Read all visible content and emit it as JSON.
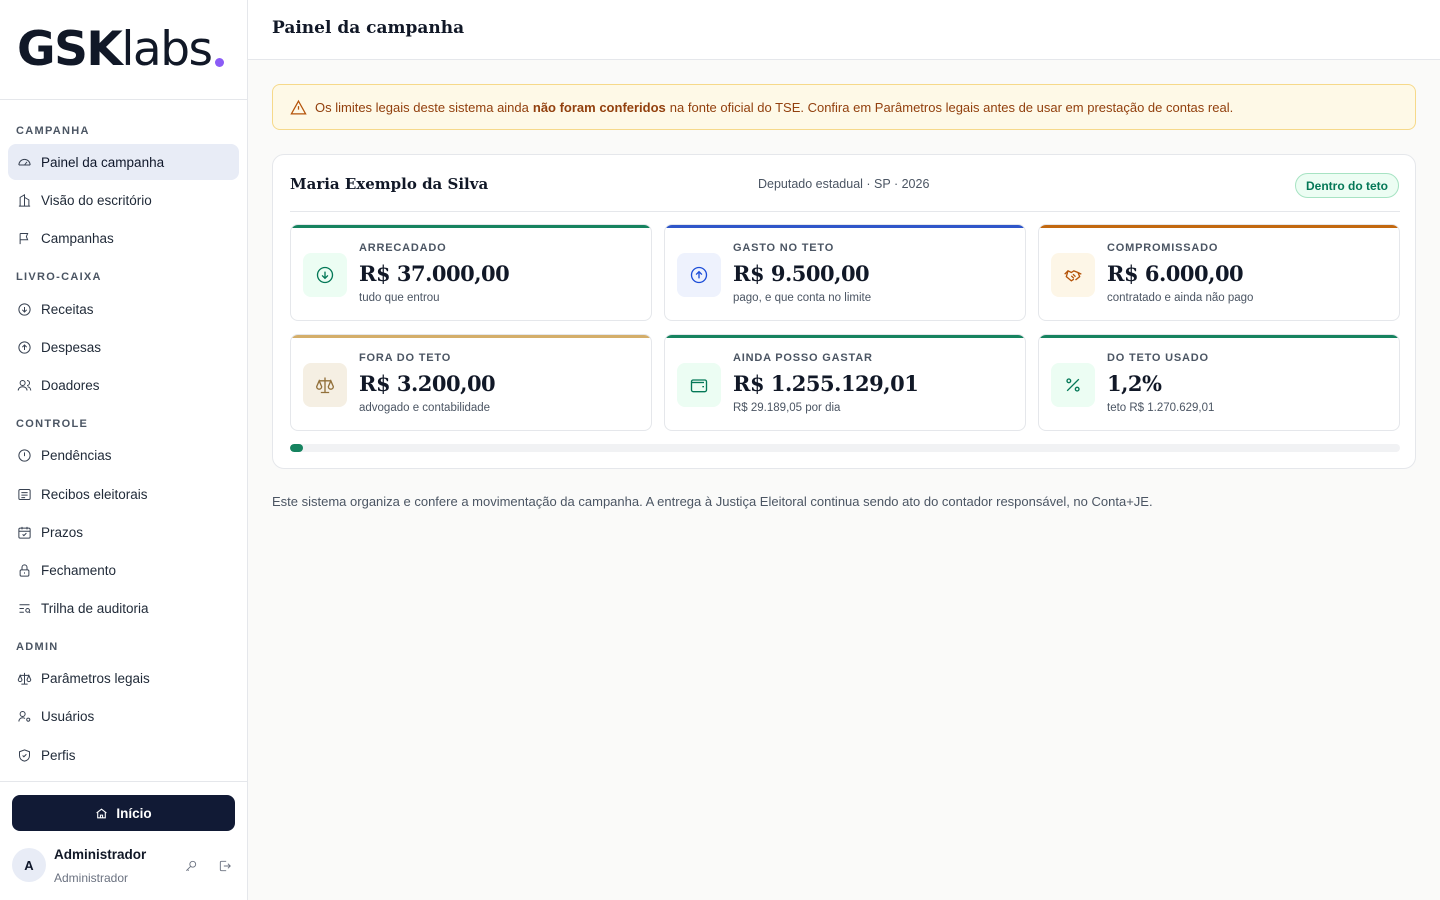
{
  "logo": {
    "bold": "GSK",
    "light": "labs"
  },
  "sidebar": {
    "sections": [
      {
        "title": "CAMPANHA",
        "items": [
          {
            "label": "Painel da campanha",
            "icon": "dashboard-icon",
            "active": true
          },
          {
            "label": "Visão do escritório",
            "icon": "building-icon"
          },
          {
            "label": "Campanhas",
            "icon": "flag-icon"
          }
        ]
      },
      {
        "title": "LIVRO-CAIXA",
        "items": [
          {
            "label": "Receitas",
            "icon": "arrow-down-circle-icon"
          },
          {
            "label": "Despesas",
            "icon": "arrow-up-circle-icon"
          },
          {
            "label": "Doadores",
            "icon": "users-icon"
          }
        ]
      },
      {
        "title": "CONTROLE",
        "items": [
          {
            "label": "Pendências",
            "icon": "alert-circle-icon"
          },
          {
            "label": "Recibos eleitorais",
            "icon": "receipt-icon"
          },
          {
            "label": "Prazos",
            "icon": "calendar-check-icon"
          },
          {
            "label": "Fechamento",
            "icon": "lock-icon"
          },
          {
            "label": "Trilha de auditoria",
            "icon": "list-search-icon"
          }
        ]
      },
      {
        "title": "ADMIN",
        "items": [
          {
            "label": "Parâmetros legais",
            "icon": "scale-icon"
          },
          {
            "label": "Usuários",
            "icon": "user-cog-icon"
          },
          {
            "label": "Perfis",
            "icon": "shield-check-icon"
          }
        ]
      }
    ],
    "home_label": "Início",
    "user": {
      "initial": "A",
      "name": "Administrador",
      "role": "Administrador"
    }
  },
  "header": {
    "title": "Painel da campanha"
  },
  "alert": {
    "before": "Os limites legais deste sistema ainda",
    "bold": "não foram conferidos",
    "after": "na fonte oficial do TSE. Confira em Parâmetros legais antes de usar em prestação de contas real."
  },
  "candidate": {
    "name": "Maria Exemplo da Silva",
    "meta": "Deputado estadual · SP · 2026",
    "status": "Dentro do teto"
  },
  "cards": [
    {
      "label": "ARRECADADO",
      "value": "R$ 37.000,00",
      "sub": "tudo que entrou",
      "accent": "#16835f",
      "icon": "arrow-down-circle-icon",
      "icon_bg": "#ecfdf3",
      "icon_color": "#047857"
    },
    {
      "label": "GASTO NO TETO",
      "value": "R$ 9.500,00",
      "sub": "pago, e que conta no limite",
      "accent": "#2f56c9",
      "icon": "arrow-up-circle-icon",
      "icon_bg": "#eef2fd",
      "icon_color": "#1d4ed8"
    },
    {
      "label": "COMPROMISSADO",
      "value": "R$ 6.000,00",
      "sub": "contratado e ainda não pago",
      "accent": "#c2680f",
      "icon": "handshake-icon",
      "icon_bg": "#fdf6e7",
      "icon_color": "#b45309"
    },
    {
      "label": "FORA DO TETO",
      "value": "R$ 3.200,00",
      "sub": "advogado e contabilidade",
      "accent": "#d4ae6a",
      "icon": "scale-icon",
      "icon_bg": "#f5efe3",
      "icon_color": "#92703a"
    },
    {
      "label": "AINDA POSSO GASTAR",
      "value": "R$ 1.255.129,01",
      "sub": "R$ 29.189,05 por dia",
      "accent": "#16835f",
      "icon": "wallet-icon",
      "icon_bg": "#ecfdf3",
      "icon_color": "#047857"
    },
    {
      "label": "DO TETO USADO",
      "value": "1,2%",
      "sub": "teto R$ 1.270.629,01",
      "accent": "#16835f",
      "icon": "percent-icon",
      "icon_bg": "#ecfdf3",
      "icon_color": "#047857"
    }
  ],
  "progress": {
    "percent": 1.2
  },
  "footnote": "Este sistema organiza e confere a movimentação da campanha. A entrega à Justiça Eleitoral continua sendo ato do contador responsável, no Conta+JE."
}
